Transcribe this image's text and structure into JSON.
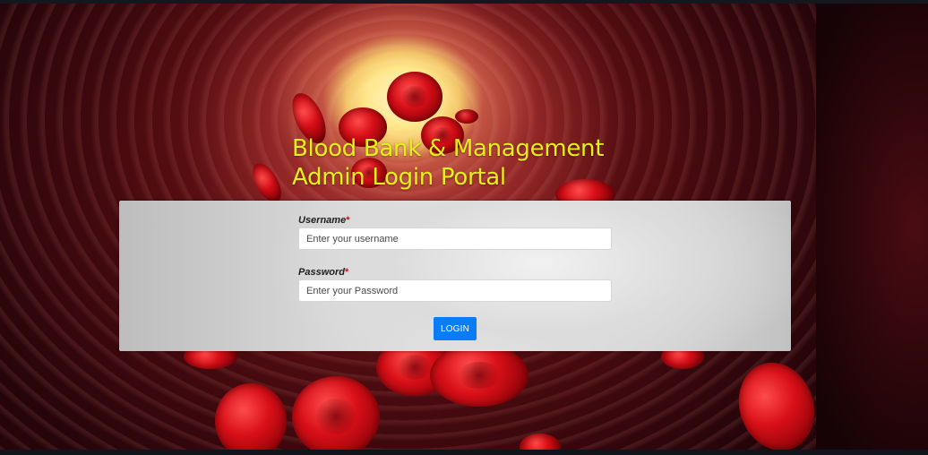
{
  "title": {
    "line1": "Blood Bank & Management",
    "line2": "Admin Login Portal"
  },
  "form": {
    "username": {
      "label": "Username",
      "required_mark": "*",
      "value": "",
      "placeholder": "Enter your username"
    },
    "password": {
      "label": "Password",
      "required_mark": "*",
      "value": "",
      "placeholder": "Enter your Password"
    },
    "login_button": "LOGIN"
  },
  "colors": {
    "title": "#e3f01a",
    "button": "#0a7cf5",
    "required": "#d4101a"
  }
}
